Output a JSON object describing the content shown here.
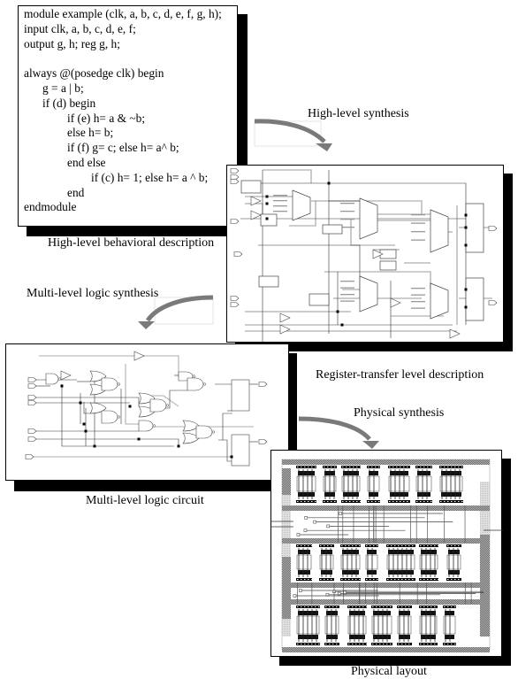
{
  "behavioral": {
    "code_lines": [
      {
        "text": "module example (clk, a, b, c, d, e, f, g, h);",
        "indent": 0
      },
      {
        "text": "input clk, a, b, c, d, e, f;",
        "indent": 0
      },
      {
        "text": "output g, h; reg g, h;",
        "indent": 0
      },
      {
        "text": "",
        "indent": 0
      },
      {
        "text": "always @(posedge clk) begin",
        "indent": 0
      },
      {
        "text": "g = a | b;",
        "indent": 1
      },
      {
        "text": "if (d) begin",
        "indent": 1
      },
      {
        "text": "if (e) h= a & ~b;",
        "indent": 2
      },
      {
        "text": "else h= b;",
        "indent": 2
      },
      {
        "text": "if (f) g= c; else h= a^ b;",
        "indent": 2
      },
      {
        "text": "end else",
        "indent": 2
      },
      {
        "text": "if (c) h= 1; else h= a ^ b;",
        "indent": 3
      },
      {
        "text": "end",
        "indent": 2
      },
      {
        "text": "endmodule",
        "indent": 0
      }
    ],
    "caption": "High-level behavioral description"
  },
  "steps": {
    "high_level_synthesis": "High-level synthesis",
    "multi_level_logic_synthesis": "Multi-level logic synthesis",
    "physical_synthesis": "Physical synthesis"
  },
  "rtl": {
    "caption": "Register-transfer level description"
  },
  "logic": {
    "caption": "Multi-level logic circuit"
  },
  "layout": {
    "caption": "Physical layout"
  },
  "colors": {
    "arrow": "#7a7a7a",
    "shadow": "#000000",
    "wire_gray": "#bdbdbd",
    "layout_gray": "#8c8c8c"
  }
}
